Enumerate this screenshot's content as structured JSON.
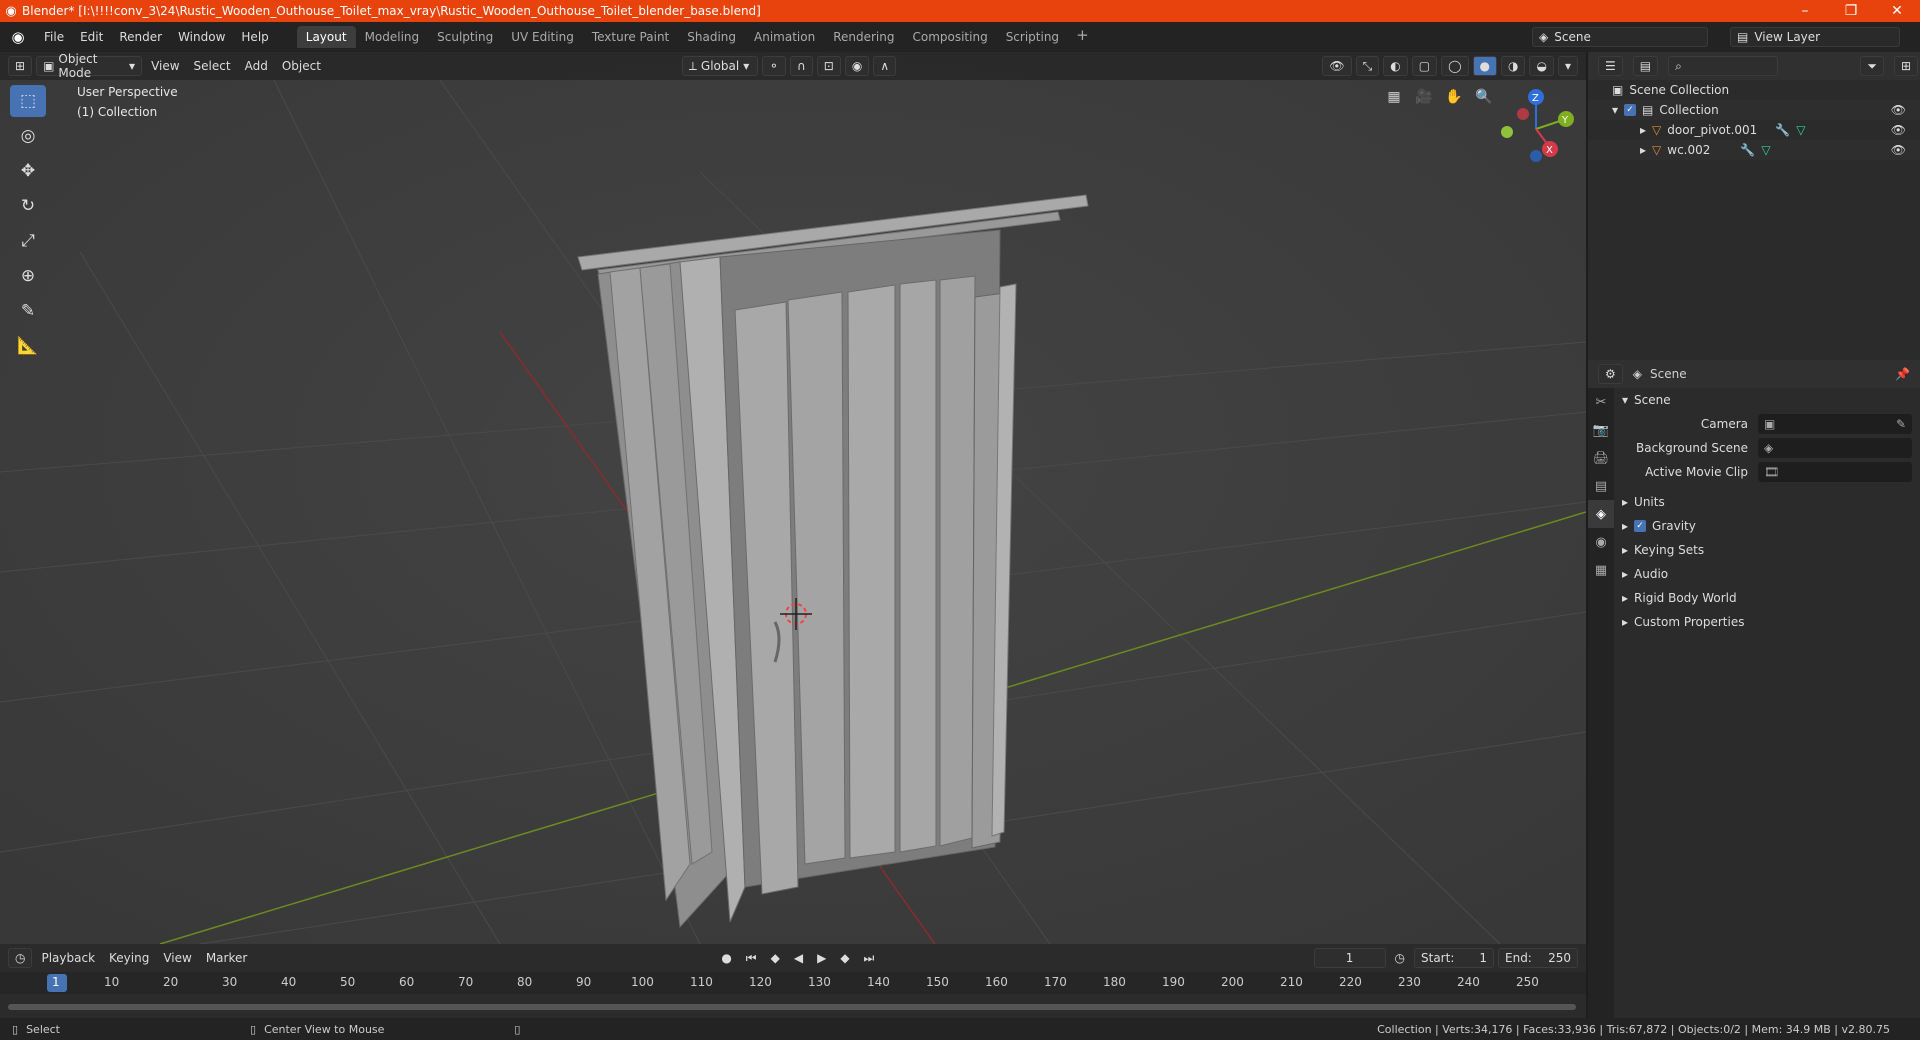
{
  "titlebar": {
    "title": "Blender* [I:\\!!!!conv_3\\24\\Rustic_Wooden_Outhouse_Toilet_max_vray\\Rustic_Wooden_Outhouse_Toilet_blender_base.blend]",
    "minimize": "–",
    "maximize": "❐",
    "close": "✕"
  },
  "menu": [
    "File",
    "Edit",
    "Render",
    "Window",
    "Help"
  ],
  "workspaces": [
    "Layout",
    "Modeling",
    "Sculpting",
    "UV Editing",
    "Texture Paint",
    "Shading",
    "Animation",
    "Rendering",
    "Compositing",
    "Scripting"
  ],
  "active_workspace": "Layout",
  "scene_name": "Scene",
  "view_layer_name": "View Layer",
  "viewport": {
    "mode": "Object Mode",
    "menus": [
      "View",
      "Select",
      "Add",
      "Object"
    ],
    "transform_orientation": "Global",
    "perspective_label": "User Perspective",
    "collection_label": "(1) Collection",
    "axis_x": "X",
    "axis_y": "Y",
    "axis_z": "Z"
  },
  "outliner": {
    "root": "Scene Collection",
    "collection": "Collection",
    "objects": [
      "door_pivot.001",
      "wc.002"
    ]
  },
  "properties": {
    "header": "Scene",
    "panel": "Scene",
    "camera_label": "Camera",
    "background_scene_label": "Background Scene",
    "active_movie_clip_label": "Active Movie Clip",
    "subpanels": [
      "Units",
      "Gravity",
      "Keying Sets",
      "Audio",
      "Rigid Body World",
      "Custom Properties"
    ]
  },
  "timeline": {
    "menus": [
      "Playback",
      "Keying",
      "View",
      "Marker"
    ],
    "current_frame": "1",
    "start_label": "Start:",
    "start_value": "1",
    "end_label": "End:",
    "end_value": "250",
    "ruler": [
      "1",
      "10",
      "20",
      "30",
      "40",
      "50",
      "60",
      "70",
      "80",
      "90",
      "100",
      "110",
      "120",
      "130",
      "140",
      "150",
      "160",
      "170",
      "180",
      "190",
      "200",
      "210",
      "220",
      "230",
      "240",
      "250"
    ]
  },
  "status": {
    "left": "Select",
    "middle": "Center View to Mouse",
    "right": "Collection | Verts:34,176 | Faces:33,936 | Tris:67,872 | Objects:0/2 | Mem: 34.9 MB | v2.80.75"
  },
  "colors": {
    "titlebar": "#e8430c",
    "accent": "#4772b3",
    "grid_x": "#8b2b2b",
    "grid_y": "#6b8b20"
  }
}
